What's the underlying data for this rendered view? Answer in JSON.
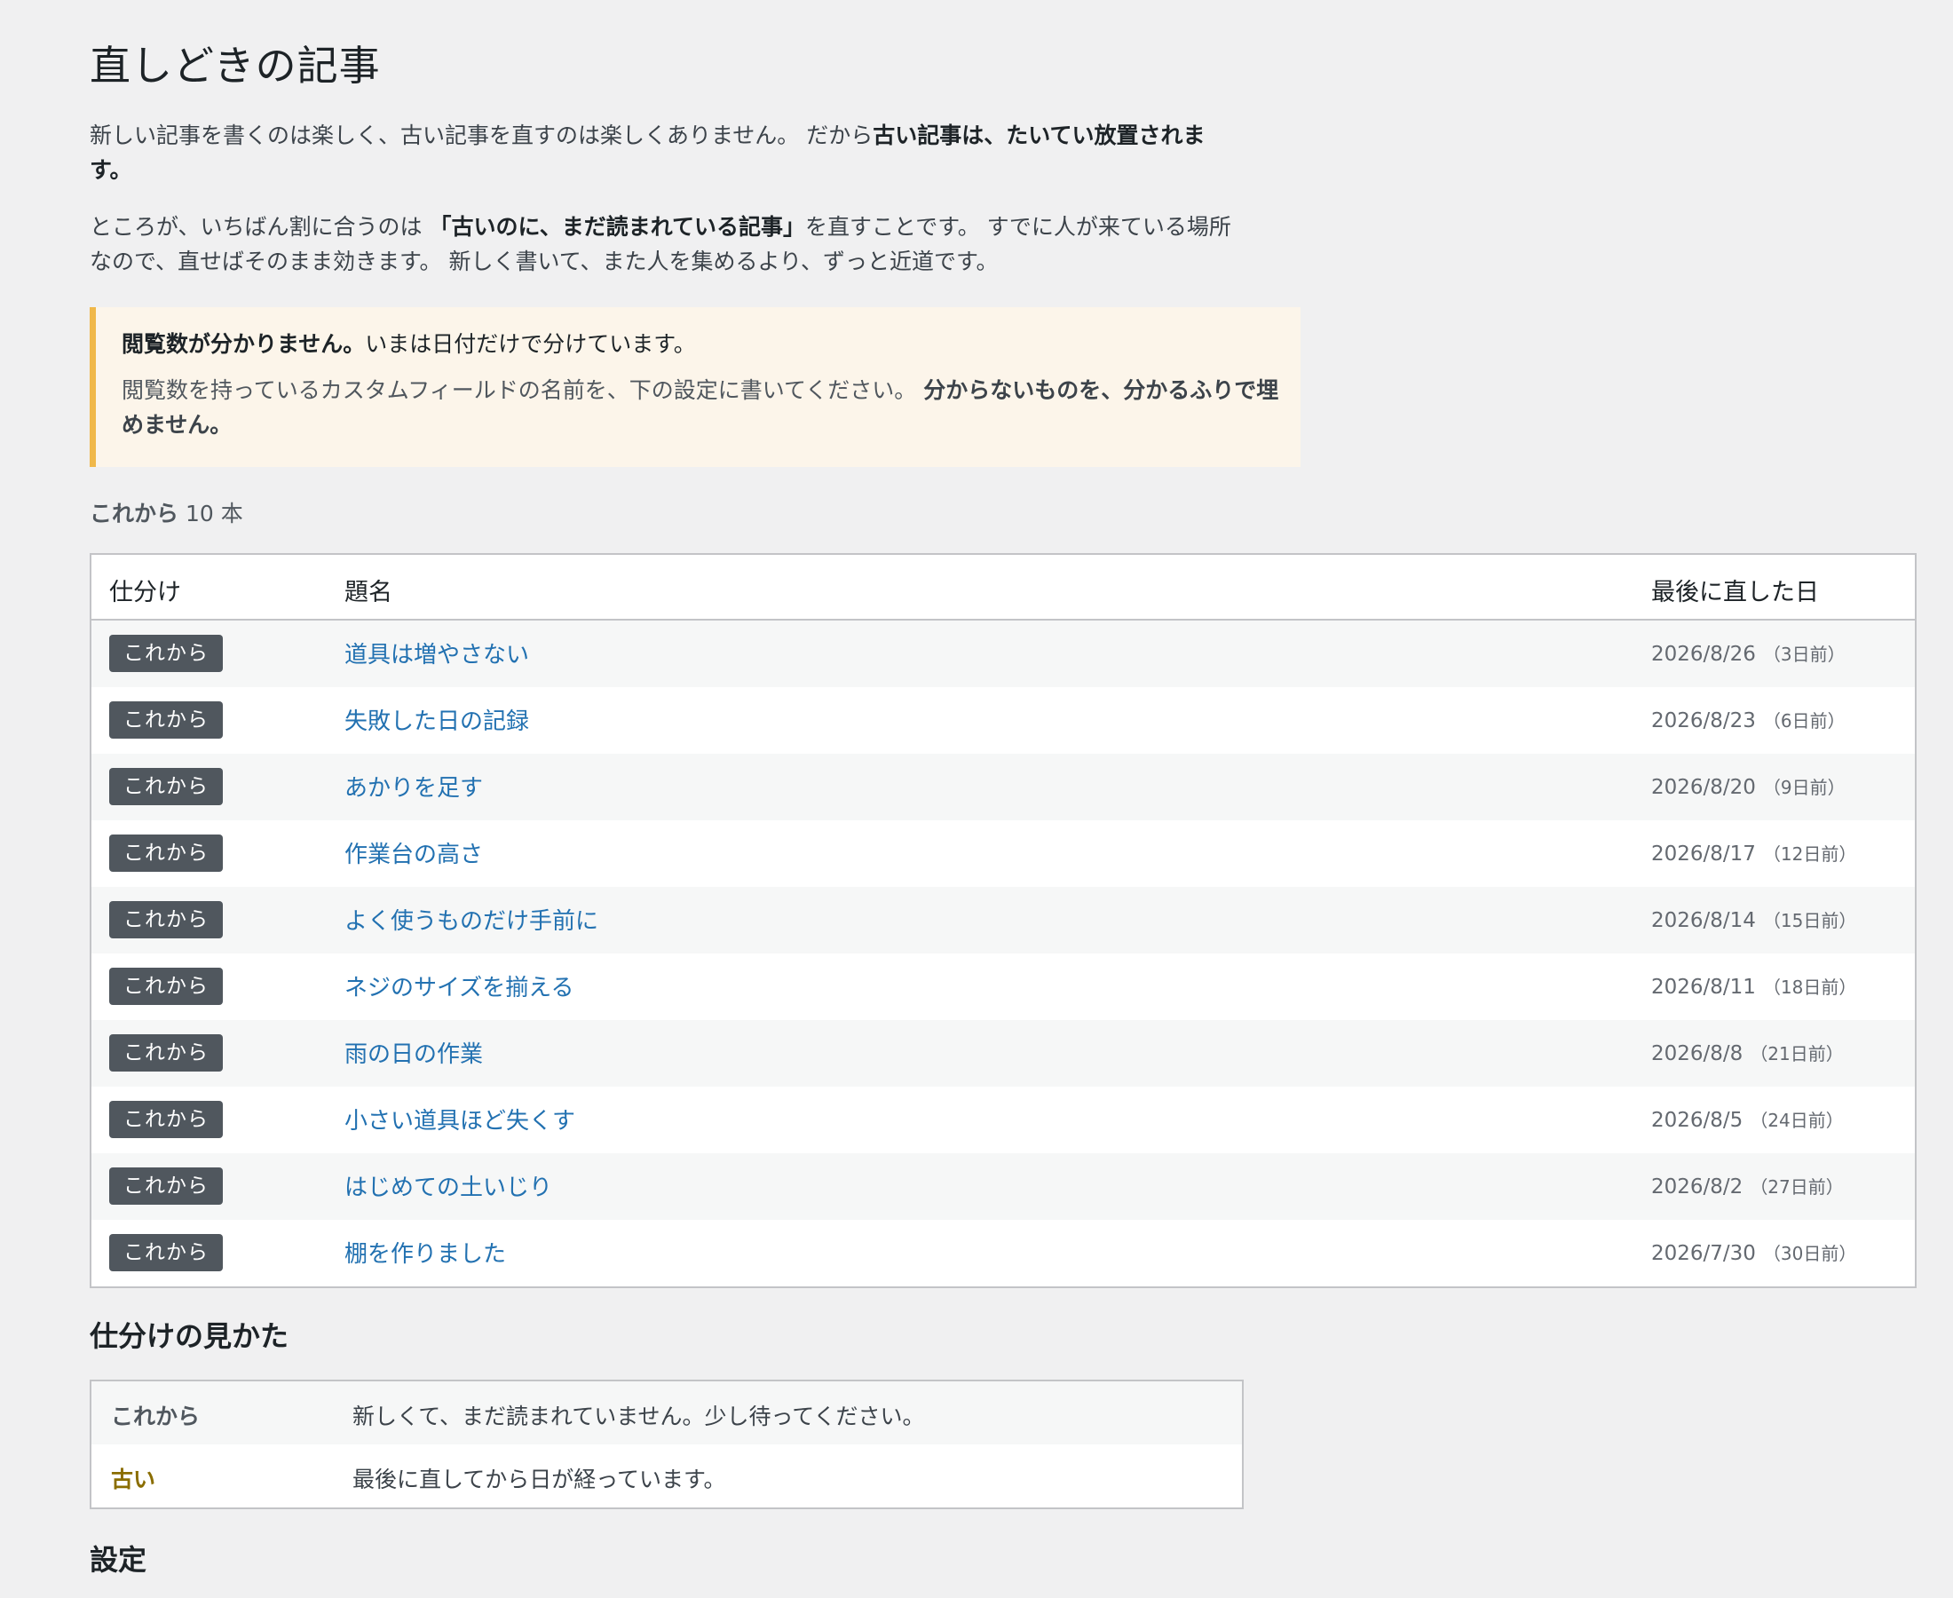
{
  "page": {
    "title": "直しどきの記事",
    "intro1_a": "新しい記事を書くのは楽しく、古い記事を直すのは楽しくありません。 だから",
    "intro1_b": "古い記事は、たいてい放置されます。",
    "intro2_a": "ところが、いちばん割に合うのは ",
    "intro2_b": "「古いのに、まだ読まれている記事」",
    "intro2_c": "を直すことです。 すでに人が来ている場所なので、直せばそのまま効きます。 新しく書いて、また人を集めるより、ずっと近道です。"
  },
  "notice": {
    "strong": "閲覧数が分かりません。",
    "text": "いまは日付だけで分けています。",
    "detail": "閲覧数を持っているカスタムフィールドの名前を、下の設定に書いてください。 ",
    "detail_strong": "分からないものを、分かるふりで埋めません。",
    "accent": "#f0b849"
  },
  "summary": {
    "label": "これから",
    "count": "10 本"
  },
  "table": {
    "headers": {
      "category": "仕分け",
      "title": "題名",
      "last": "最後に直した日"
    },
    "rows": [
      {
        "badge": "これから",
        "title": "道具は増やさない",
        "date": "2026/8/26",
        "ago": "（3日前）"
      },
      {
        "badge": "これから",
        "title": "失敗した日の記録",
        "date": "2026/8/23",
        "ago": "（6日前）"
      },
      {
        "badge": "これから",
        "title": "あかりを足す",
        "date": "2026/8/20",
        "ago": "（9日前）"
      },
      {
        "badge": "これから",
        "title": "作業台の高さ",
        "date": "2026/8/17",
        "ago": "（12日前）"
      },
      {
        "badge": "これから",
        "title": "よく使うものだけ手前に",
        "date": "2026/8/14",
        "ago": "（15日前）"
      },
      {
        "badge": "これから",
        "title": "ネジのサイズを揃える",
        "date": "2026/8/11",
        "ago": "（18日前）"
      },
      {
        "badge": "これから",
        "title": "雨の日の作業",
        "date": "2026/8/8",
        "ago": "（21日前）"
      },
      {
        "badge": "これから",
        "title": "小さい道具ほど失くす",
        "date": "2026/8/5",
        "ago": "（24日前）"
      },
      {
        "badge": "これから",
        "title": "はじめての土いじり",
        "date": "2026/8/2",
        "ago": "（27日前）"
      },
      {
        "badge": "これから",
        "title": "棚を作りました",
        "date": "2026/7/30",
        "ago": "（30日前）"
      }
    ]
  },
  "legend": {
    "heading": "仕分けの見かた",
    "items": [
      {
        "key": "これから",
        "color": "#50575e",
        "desc": "新しくて、まだ読まれていません。少し待ってください。"
      },
      {
        "key": "古い",
        "color": "#8a6d00",
        "desc": "最後に直してから日が経っています。"
      }
    ]
  },
  "settings": {
    "heading": "設定"
  },
  "colors": {
    "link": "#2271b1",
    "badge": "#50575e"
  }
}
